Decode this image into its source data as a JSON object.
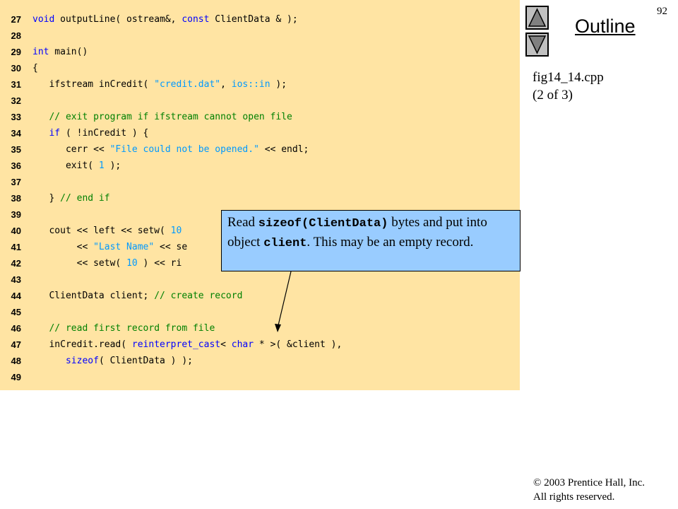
{
  "slide": {
    "page_number": "92",
    "outline_title": "Outline",
    "file_name": "fig14_14.cpp",
    "file_part": "(2 of 3)",
    "copyright_line1": "© 2003 Prentice Hall, Inc.",
    "copyright_line2": "All rights reserved."
  },
  "nav": {
    "up_icon": "triangle-up-icon",
    "down_icon": "triangle-down-icon"
  },
  "colors": {
    "code_background": "#FFE4A3",
    "keyword": "#0000FF",
    "string": "#0099FF",
    "comment": "#008000",
    "callout_background": "#99CCFF"
  },
  "code_lines": [
    {
      "n": "27",
      "segs": [
        {
          "t": "void",
          "c": "kw"
        },
        {
          "t": " outputLine( ostream&, "
        },
        {
          "t": "const",
          "c": "kw"
        },
        {
          "t": " ClientData & );"
        }
      ]
    },
    {
      "n": "28",
      "segs": []
    },
    {
      "n": "29",
      "segs": [
        {
          "t": "int",
          "c": "kw"
        },
        {
          "t": " main()"
        }
      ]
    },
    {
      "n": "30",
      "segs": [
        {
          "t": "{"
        }
      ]
    },
    {
      "n": "31",
      "segs": [
        {
          "t": "   ifstream inCredit( "
        },
        {
          "t": "\"credit.dat\"",
          "c": "str"
        },
        {
          "t": ", "
        },
        {
          "t": "ios::in",
          "c": "str"
        },
        {
          "t": " );"
        }
      ]
    },
    {
      "n": "32",
      "segs": []
    },
    {
      "n": "33",
      "segs": [
        {
          "t": "   "
        },
        {
          "t": "// exit program if ifstream cannot open file",
          "c": "cm"
        }
      ]
    },
    {
      "n": "34",
      "segs": [
        {
          "t": "   "
        },
        {
          "t": "if",
          "c": "kw"
        },
        {
          "t": " ( !inCredit ) {"
        }
      ]
    },
    {
      "n": "35",
      "segs": [
        {
          "t": "      cerr << "
        },
        {
          "t": "\"File could not be opened.\"",
          "c": "str"
        },
        {
          "t": " << endl;"
        }
      ]
    },
    {
      "n": "36",
      "segs": [
        {
          "t": "      exit( "
        },
        {
          "t": "1",
          "c": "num"
        },
        {
          "t": " );"
        }
      ]
    },
    {
      "n": "37",
      "segs": []
    },
    {
      "n": "38",
      "segs": [
        {
          "t": "   } "
        },
        {
          "t": "// end if",
          "c": "cm"
        }
      ]
    },
    {
      "n": "39",
      "segs": []
    },
    {
      "n": "40",
      "segs": [
        {
          "t": "   cout << left << setw( "
        },
        {
          "t": "10",
          "c": "num"
        }
      ]
    },
    {
      "n": "41",
      "segs": [
        {
          "t": "        << "
        },
        {
          "t": "\"Last Name\"",
          "c": "str"
        },
        {
          "t": " << se"
        }
      ]
    },
    {
      "n": "42",
      "segs": [
        {
          "t": "        << setw( "
        },
        {
          "t": "10",
          "c": "num"
        },
        {
          "t": " ) << ri"
        }
      ]
    },
    {
      "n": "43",
      "segs": []
    },
    {
      "n": "44",
      "segs": [
        {
          "t": "   ClientData client; "
        },
        {
          "t": "// create record",
          "c": "cm"
        }
      ]
    },
    {
      "n": "45",
      "segs": []
    },
    {
      "n": "46",
      "segs": [
        {
          "t": "   "
        },
        {
          "t": "// read first record from file",
          "c": "cm"
        }
      ]
    },
    {
      "n": "47",
      "segs": [
        {
          "t": "   inCredit.read( "
        },
        {
          "t": "reinterpret_cast",
          "c": "kw"
        },
        {
          "t": "< "
        },
        {
          "t": "char",
          "c": "kw"
        },
        {
          "t": " * >( &client ),"
        }
      ]
    },
    {
      "n": "48",
      "segs": [
        {
          "t": "      "
        },
        {
          "t": "sizeof",
          "c": "kw"
        },
        {
          "t": "( ClientData ) );"
        }
      ]
    },
    {
      "n": "49",
      "segs": []
    }
  ],
  "callout": {
    "part1": "Read ",
    "code1": "sizeof(ClientData)",
    "part2": " bytes and put into object ",
    "code2": "client",
    "part3": ". This may be an empty record."
  }
}
